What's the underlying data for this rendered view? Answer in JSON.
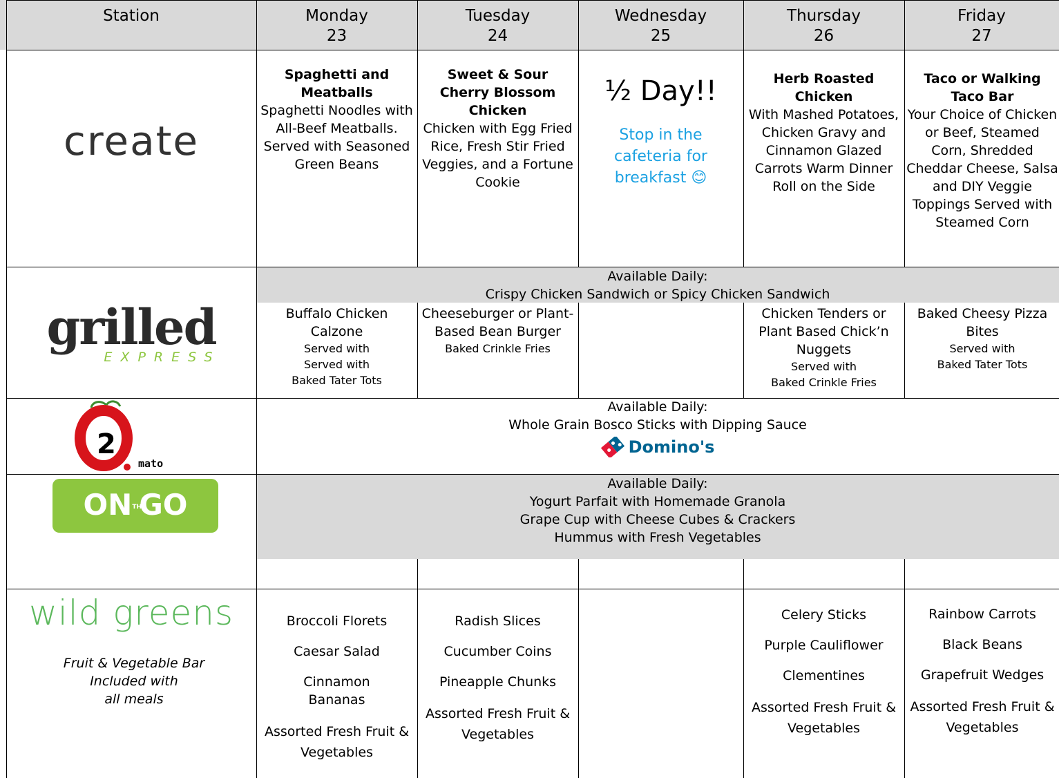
{
  "header": {
    "station": "Station",
    "days": [
      {
        "name": "Monday",
        "date": "23"
      },
      {
        "name": "Tuesday",
        "date": "24"
      },
      {
        "name": "Wednesday",
        "date": "25"
      },
      {
        "name": "Thursday",
        "date": "26"
      },
      {
        "name": "Friday",
        "date": "27"
      }
    ]
  },
  "create": {
    "logo": "create",
    "monday": {
      "title": "Spaghetti and Meatballs",
      "body": "Spaghetti Noodles with All-Beef Meatballs. Served with Seasoned Green Beans"
    },
    "tuesday": {
      "title": "Sweet & Sour Cherry Blossom Chicken",
      "body": "Chicken with Egg Fried Rice, Fresh Stir Fried Veggies, and a Fortune Cookie"
    },
    "wednesday": {
      "title": "½ Day!!",
      "body": "Stop in the cafeteria for breakfast 😊"
    },
    "thursday": {
      "title": "Herb Roasted Chicken",
      "body": "With Mashed Potatoes, Chicken Gravy and  Cinnamon Glazed Carrots Warm Dinner Roll on the Side"
    },
    "friday": {
      "title": "Taco or Walking Taco Bar",
      "body": "Your Choice of Chicken or Beef, Steamed Corn, Shredded Cheddar Cheese, Salsa and DIY Veggie Toppings Served with Steamed Corn"
    }
  },
  "grilled": {
    "logo_main": "grilled",
    "logo_sub": "EXPRESS",
    "daily_label": "Available Daily:",
    "daily_item": "Crispy Chicken Sandwich or Spicy Chicken Sandwich",
    "monday": {
      "main": "Buffalo Chicken Calzone",
      "side1": "Served with",
      "side2": "Served with",
      "side3": "Baked Tater Tots"
    },
    "tuesday": {
      "main": "Cheeseburger or Plant-Based Bean Burger",
      "side1": "Baked Crinkle Fries"
    },
    "thursday": {
      "main": "Chicken Tenders or Plant Based Chick’n Nuggets",
      "side1": "Served with",
      "side2": "Baked Crinkle Fries"
    },
    "friday": {
      "main": "Baked Cheesy Pizza Bites",
      "side1": "Served with",
      "side2": "Baked Tater Tots"
    }
  },
  "o2mato": {
    "logo_num": "2",
    "logo_text": "mato",
    "daily_label": "Available Daily:",
    "daily_item": "Whole Grain Bosco Sticks with Dipping Sauce",
    "brand": "Domino's"
  },
  "onthego": {
    "logo_left": "ON",
    "logo_mid": "THE",
    "logo_right": "GO",
    "daily_label": "Available Daily:",
    "items": [
      "Yogurt Parfait with Homemade Granola",
      "Grape Cup with Cheese Cubes & Crackers",
      "Hummus with Fresh Vegetables"
    ]
  },
  "wildgreens": {
    "logo": "wild greens",
    "desc1": "Fruit & Vegetable Bar",
    "desc2": "Included with",
    "desc3": "all meals",
    "monday": [
      "Broccoli Florets",
      "Caesar Salad",
      "Cinnamon Bananas",
      "Assorted Fresh Fruit & Vegetables"
    ],
    "tuesday": [
      "Radish Slices",
      "Cucumber Coins",
      "Pineapple Chunks",
      "Assorted Fresh Fruit & Vegetables"
    ],
    "thursday": [
      "Celery Sticks",
      "Purple Cauliflower",
      "Clementines",
      "Assorted Fresh Fruit & Vegetables"
    ],
    "friday": [
      "Rainbow Carrots",
      "Black Beans",
      "Grapefruit Wedges",
      "Assorted Fresh Fruit & Vegetables"
    ]
  },
  "colors": {
    "header_bg": "#d9d9d9",
    "daily_bg": "#d9d9d9",
    "accent_blue": "#1ba1e2",
    "green": "#8dc63f"
  }
}
